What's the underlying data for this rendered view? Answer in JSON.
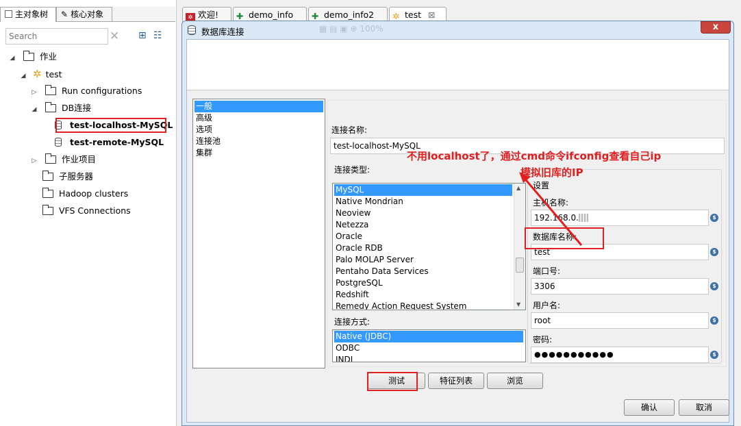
{
  "left_panel": {
    "tabs": [
      {
        "label": "主对象树"
      },
      {
        "label": "核心对象"
      }
    ],
    "search_placeholder": "Search",
    "tree": [
      {
        "label": "作业"
      },
      {
        "label": "test"
      },
      {
        "label": "Run configurations"
      },
      {
        "label": "DB连接"
      },
      {
        "label": "test-localhost-MySQL"
      },
      {
        "label": "test-remote-MySQL"
      },
      {
        "label": "作业项目"
      },
      {
        "label": "子服务器"
      },
      {
        "label": "Hadoop clusters"
      },
      {
        "label": "VFS Connections"
      }
    ]
  },
  "editor_tabs": [
    {
      "label": "欢迎!"
    },
    {
      "label": "demo_info"
    },
    {
      "label": "demo_info2"
    },
    {
      "label": "test"
    }
  ],
  "toolbar": {
    "zoom": "100%"
  },
  "dialog": {
    "title": "数据库连接",
    "close_glyph": "x",
    "categories": [
      "一般",
      "高级",
      "选项",
      "连接池",
      "集群"
    ],
    "connection_name_label": "连接名称:",
    "connection_name_value": "test-localhost-MySQL",
    "connection_type_label": "连接类型:",
    "connection_types": [
      "MySQL",
      "Native Mondrian",
      "Neoview",
      "Netezza",
      "Oracle",
      "Oracle RDB",
      "Palo MOLAP Server",
      "Pentaho Data Services",
      "PostgreSQL",
      "Redshift",
      "Remedy Action Request System"
    ],
    "access_label": "连接方式:",
    "access_types": [
      "Native (JDBC)",
      "ODBC",
      "JNDI"
    ],
    "settings": {
      "title": "设置",
      "host_label": "主机名称:",
      "host_value": "192.168.0.",
      "dbname_label": "数据库名称:",
      "dbname_value": "test",
      "port_label": "端口号:",
      "port_value": "3306",
      "user_label": "用户名:",
      "user_value": "root",
      "password_label": "密码:",
      "password_value": "●●●●●●●●●●●"
    },
    "buttons": {
      "test": "测试",
      "features": "特征列表",
      "browse": "浏览",
      "ok": "确认",
      "cancel": "取消"
    }
  },
  "annotation": {
    "line1": "不用localhost了，通过cmd命令ifconfig查看自己ip",
    "line2": "模拟旧库的IP",
    "color": "#e02020"
  },
  "colors": {
    "selection": "#3399ff",
    "dialog_frame": "#dbe8f6",
    "close_button": "#c9463d"
  }
}
